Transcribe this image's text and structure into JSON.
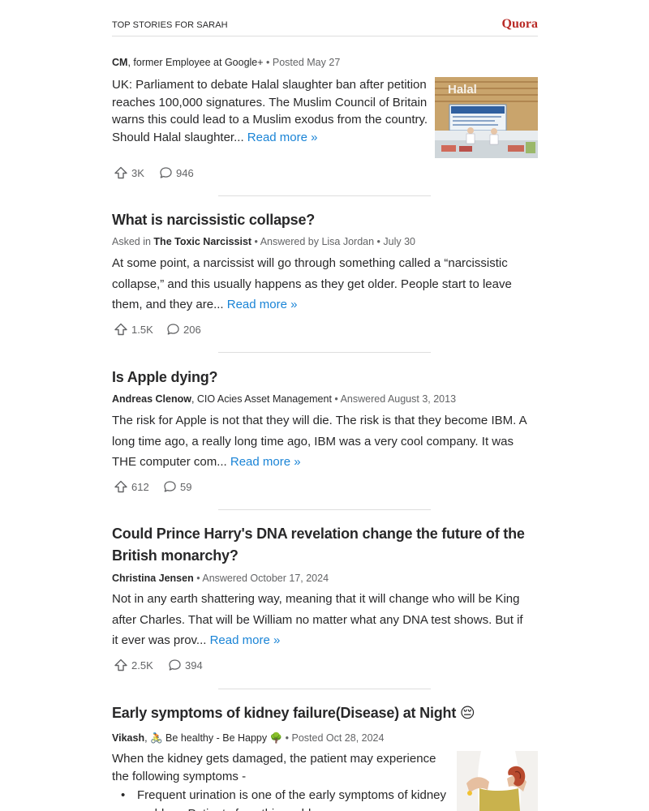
{
  "header": {
    "title": "TOP STORIES FOR SARAH",
    "brand": "Quora",
    "brand_color": "#b92b27"
  },
  "stories": [
    {
      "author": "CM",
      "credential": ", former Employee at Google+",
      "posted": " • Posted May 27",
      "body": "UK: Parliament to debate Halal slaughter ban after petition reaches 100,000 signatures. The Muslim Council of Britain warns this could lead to a Muslim exodus from the country. Should Halal slaughter... ",
      "read_more": "Read more »",
      "image_sign": "Halal",
      "upvotes": "3K",
      "comments": "946"
    },
    {
      "title": "What is narcissistic collapse?",
      "asked_prefix": "Asked in ",
      "space": "The Toxic Narcissist",
      "answered": " • Answered by Lisa Jordan • July 30",
      "body": "At some point, a narcissist will go through something called a “narcissistic collapse,” and this usually happens as they get older. People start to leave them, and they are... ",
      "read_more": "Read more »",
      "upvotes": "1.5K",
      "comments": "206"
    },
    {
      "title": "Is Apple dying?",
      "author": "Andreas Clenow",
      "credential": ", CIO Acies Asset Management",
      "answered": " • Answered August 3, 2013",
      "body": "The risk for Apple is not that they will die. The risk is that they become IBM. A long time ago, a really long time ago, IBM was a very cool company. It was THE computer com... ",
      "read_more": "Read more »",
      "upvotes": "612",
      "comments": "59"
    },
    {
      "title": "Could Prince Harry's DNA revelation change the future of the British monarchy?",
      "author": "Christina Jensen",
      "answered": " • Answered October 17, 2024",
      "body": "Not in any earth shattering way, meaning that it will change who will be King after Charles. That will be William no matter what any DNA test shows. But if it ever was prov... ",
      "read_more": "Read more »",
      "upvotes": "2.5K",
      "comments": "394"
    },
    {
      "title": "Early symptoms of kidney failure(Disease) at Night 😔",
      "author": "Vikash",
      "credential": ", 🚴 Be healthy - Be Happy 🌳",
      "posted": " • Posted Oct 28, 2024",
      "body": "When the kidney gets damaged, the patient may experience the following symptoms -",
      "bullets": [
        "Frequent urination is one of the early symptoms of kidney",
        "problem. Patients face this problem"
      ]
    }
  ]
}
